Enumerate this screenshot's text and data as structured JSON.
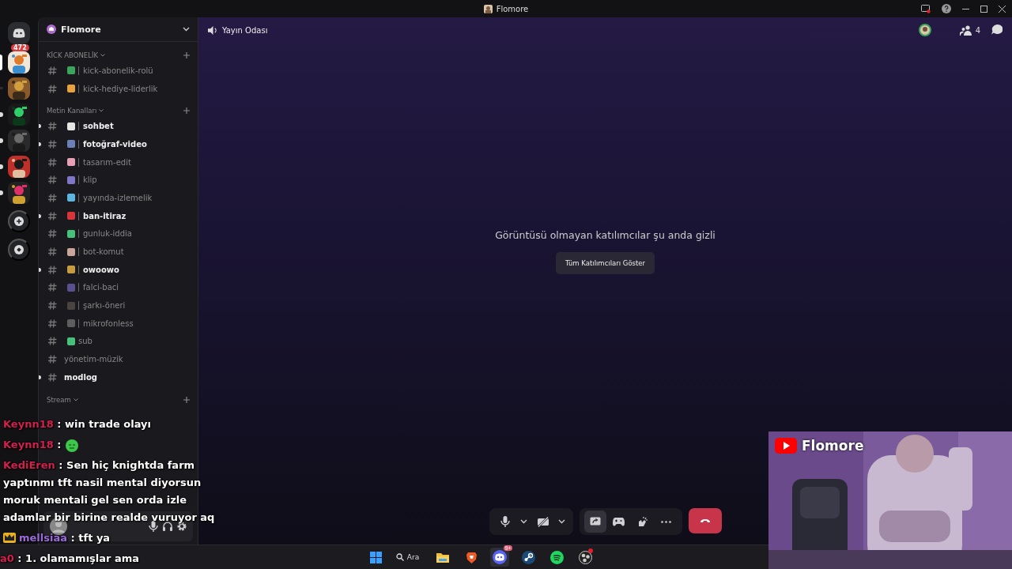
{
  "window": {
    "title": "Flomore"
  },
  "server_rail": {
    "home_badge": "472",
    "servers": [
      {
        "selected": true,
        "unread": false
      },
      {
        "selected": false,
        "unread": false
      },
      {
        "selected": false,
        "unread": true
      },
      {
        "selected": false,
        "unread": true
      },
      {
        "selected": false,
        "unread": true
      },
      {
        "selected": false,
        "unread": true
      }
    ]
  },
  "sidebar": {
    "server_name": "Flomore",
    "categories": [
      {
        "name": "KİCK ABONELİK",
        "channels": [
          {
            "name": "kick-abonelik-rolü",
            "kind": "decorated",
            "color": "#3ba55c",
            "unread": false
          },
          {
            "name": "kick-hediye-liderlik",
            "kind": "decorated",
            "color": "#e8a23a",
            "unread": false
          }
        ]
      },
      {
        "name": "Metin Kanalları",
        "channels": [
          {
            "name": "sohbet",
            "kind": "decorated",
            "color": "#e6e6e6",
            "unread": true
          },
          {
            "name": "fotoğraf-video",
            "kind": "decorated",
            "color": "#6b7fb8",
            "unread": true
          },
          {
            "name": "tasarım-edit",
            "kind": "decorated",
            "color": "#e7a0b5",
            "unread": false
          },
          {
            "name": "klip",
            "kind": "decorated",
            "color": "#7f76c9",
            "unread": false
          },
          {
            "name": "yayında-izlemelik",
            "kind": "decorated",
            "color": "#58b6e0",
            "unread": false
          },
          {
            "name": "ban-itiraz",
            "kind": "decorated",
            "color": "#d9343a",
            "unread": true
          },
          {
            "name": "gunluk-iddia",
            "kind": "decorated",
            "color": "#45c27a",
            "unread": false
          },
          {
            "name": "bot-komut",
            "kind": "decorated",
            "color": "#c9a59a",
            "unread": false
          },
          {
            "name": "owoowo",
            "kind": "decorated",
            "color": "#c79b3f",
            "unread": true
          },
          {
            "name": "falci-baci",
            "kind": "decorated",
            "color": "#5a4f8f",
            "unread": false
          },
          {
            "name": "şarkı-öneri",
            "kind": "decorated",
            "color": "#4a4440",
            "unread": false
          },
          {
            "name": "mikrofonless",
            "kind": "decorated",
            "color": "#5e5e5e",
            "unread": false
          },
          {
            "name": "sub",
            "kind": "icon_only",
            "color": "#45c27a",
            "unread": false
          },
          {
            "name": "yönetim-müzik",
            "kind": "plain",
            "unread": false
          },
          {
            "name": "modlog",
            "kind": "plain",
            "unread": true
          }
        ]
      },
      {
        "name": "Stream"
      }
    ]
  },
  "header": {
    "channel": "Yayın Odası",
    "participant_count": "4"
  },
  "stage": {
    "message": "Görüntüsü olmayan katılımcılar şu anda gizli",
    "button": "Tüm Katılımcıları Göster"
  },
  "call_controls": [
    {
      "kind": "mic"
    },
    {
      "kind": "chevron"
    },
    {
      "kind": "camera_off"
    },
    {
      "kind": "chevron"
    },
    {
      "kind": "share",
      "selected": true
    },
    {
      "kind": "activity",
      "selected": false
    },
    {
      "kind": "effects",
      "selected": false
    },
    {
      "kind": "more",
      "selected": false
    },
    {
      "kind": "hangup"
    }
  ],
  "chat_overlay": [
    {
      "user": "Keynn18",
      "color": "#d4204f",
      "separator": ":",
      "text": "win trade olayı"
    },
    {
      "user": "Keynn18",
      "color": "#d4204f",
      "separator": ":",
      "kind": "emote"
    },
    {
      "user": "KediEren",
      "color": "#d4204f",
      "separator": ":",
      "text": "Sen hiç knightda farm yaptınmı tft nasil mental diyorsun moruk mentali gel sen orda izle adamlar bir birine realde vuruyor aq"
    },
    {
      "user": "mellsiaa",
      "color": "#9b6bdc",
      "kind": "crowned",
      "separator": ":",
      "text": "tft ya"
    },
    {
      "user": "a0",
      "color": "#d4204f",
      "separator": ":",
      "text": "1. olamamışlar ama"
    }
  ],
  "webcam": {
    "kind": "picture",
    "label": "Flomore"
  },
  "taskbar": {
    "search": "Ara",
    "apps": [
      {
        "kind": "explorer"
      },
      {
        "kind": "brave"
      },
      {
        "kind": "discord",
        "badge": "9+",
        "selected": true
      },
      {
        "kind": "steam"
      },
      {
        "kind": "spotify"
      },
      {
        "kind": "obs",
        "alert": true
      }
    ]
  }
}
